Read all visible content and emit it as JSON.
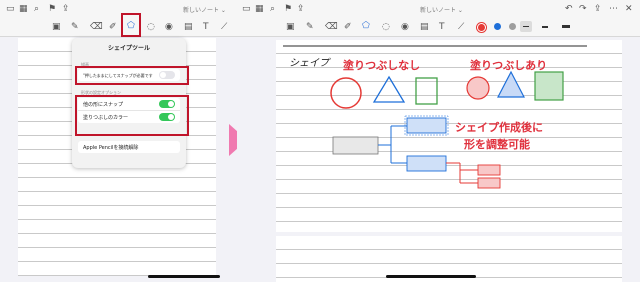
{
  "icons": {
    "top": [
      "sidebar-icon",
      "grid-icon",
      "search-icon",
      "bookmark-icon",
      "share-icon"
    ],
    "top_right": [
      "undo-icon",
      "redo-icon",
      "export-icon",
      "more-icon",
      "close-icon"
    ],
    "tools": [
      "image-icon",
      "pen-icon",
      "eraser-icon",
      "highlighter-icon",
      "shape-icon",
      "lasso-icon",
      "eye-icon",
      "camera-icon",
      "text-icon",
      "ruler-icon"
    ]
  },
  "left": {
    "doc_title": "新しいノート ⌄",
    "popup": {
      "title": "シェイプツール",
      "section1": "描画",
      "row1": "\"押したままにしてスナップが必要です",
      "section2": "形状の設定オプション",
      "row2": "他の形にスナップ",
      "row3": "塗りつぶしのカラー",
      "row4": "Apple Pencilを接続解除"
    }
  },
  "right": {
    "doc_title": "新しいノート ⌄",
    "colors": [
      "#e53935",
      "#1e6fd9",
      "#9e9e9e"
    ],
    "handwriting": "シェイプ",
    "label_nofill": "塗りつぶしなし",
    "label_fill": "塗りつぶしあり",
    "label_adjust_1": "シェイプ作成後に",
    "label_adjust_2": "形を調整可能"
  }
}
